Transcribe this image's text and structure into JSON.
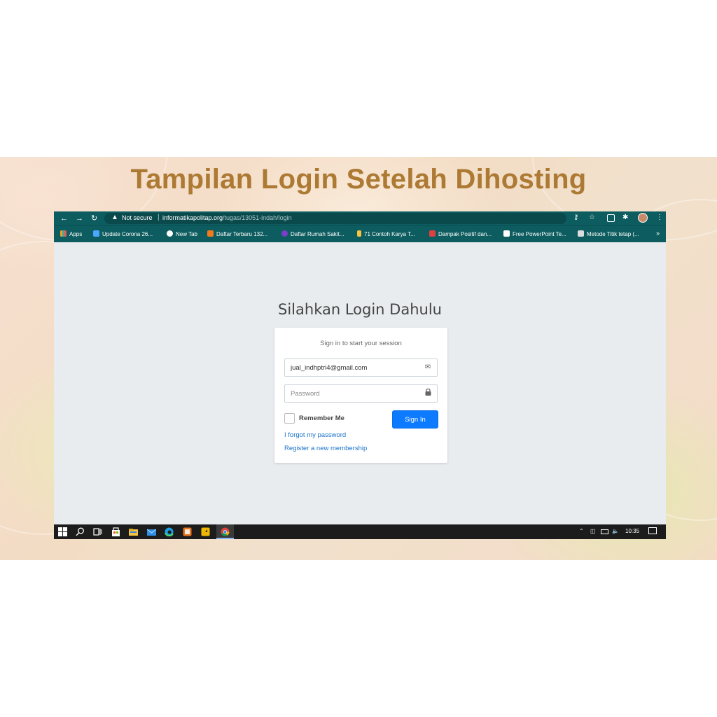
{
  "slide": {
    "title": "Tampilan Login Setelah Dihosting"
  },
  "browser": {
    "security_label": "Not secure",
    "url_host": "informatikapolitap.org",
    "url_path": "/tugas/13051-indah/login",
    "bookmarks": [
      {
        "label": "Apps",
        "color": "#f0a020"
      },
      {
        "label": "Update Corona 26...",
        "color": "#4aa8ff"
      },
      {
        "label": "New Tab",
        "color": "#ffffff"
      },
      {
        "label": "Daftar Terbaru 132...",
        "color": "#f07b1c"
      },
      {
        "label": "Daftar Rumah Sakit...",
        "color": "#7a3ec9"
      },
      {
        "label": "71 Contoh Karya T...",
        "color": "#f5c542"
      },
      {
        "label": "Dampak Positif dan...",
        "color": "#e04040"
      },
      {
        "label": "Free PowerPoint Te...",
        "color": "#ffffff"
      },
      {
        "label": "Metode Titik tetap (...",
        "color": "#dddddd"
      }
    ],
    "more_bookmarks": "»"
  },
  "login": {
    "heading": "Silahkan Login Dahulu",
    "message": "Sign in to start your session",
    "email_value": "jual_indhptri4@gmail.com",
    "password_placeholder": "Password",
    "remember_label": "Remember Me",
    "signin_label": "Sign In",
    "forgot_link": "I forgot my password",
    "register_link": "Register a new membership"
  },
  "taskbar": {
    "time": "10:35"
  },
  "colors": {
    "title": "#ad7a34",
    "browser_chrome": "#0d5c5f",
    "primary_button": "#0d7bff",
    "link": "#1a73c9"
  }
}
